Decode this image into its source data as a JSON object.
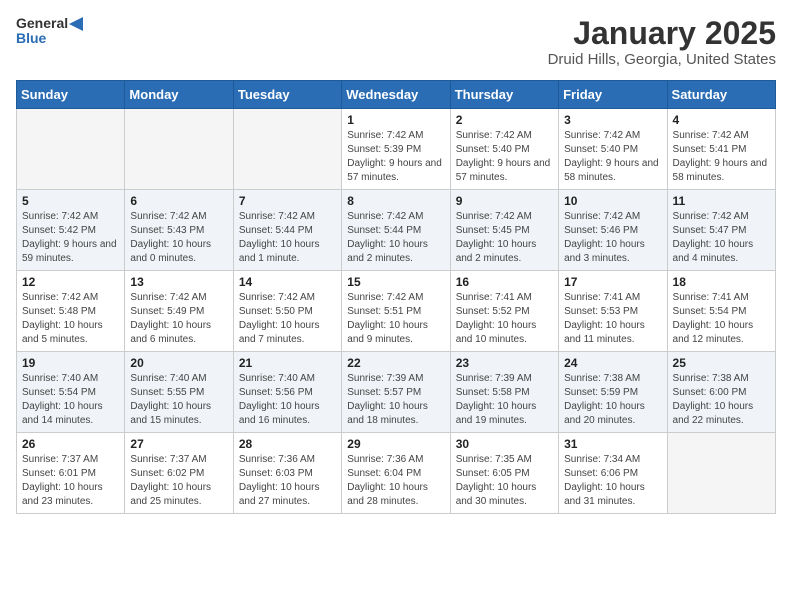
{
  "header": {
    "logo_general": "General",
    "logo_blue": "Blue",
    "month_title": "January 2025",
    "location": "Druid Hills, Georgia, United States"
  },
  "weekdays": [
    "Sunday",
    "Monday",
    "Tuesday",
    "Wednesday",
    "Thursday",
    "Friday",
    "Saturday"
  ],
  "weeks": [
    [
      {
        "day": "",
        "info": ""
      },
      {
        "day": "",
        "info": ""
      },
      {
        "day": "",
        "info": ""
      },
      {
        "day": "1",
        "info": "Sunrise: 7:42 AM\nSunset: 5:39 PM\nDaylight: 9 hours and 57 minutes."
      },
      {
        "day": "2",
        "info": "Sunrise: 7:42 AM\nSunset: 5:40 PM\nDaylight: 9 hours and 57 minutes."
      },
      {
        "day": "3",
        "info": "Sunrise: 7:42 AM\nSunset: 5:40 PM\nDaylight: 9 hours and 58 minutes."
      },
      {
        "day": "4",
        "info": "Sunrise: 7:42 AM\nSunset: 5:41 PM\nDaylight: 9 hours and 58 minutes."
      }
    ],
    [
      {
        "day": "5",
        "info": "Sunrise: 7:42 AM\nSunset: 5:42 PM\nDaylight: 9 hours and 59 minutes."
      },
      {
        "day": "6",
        "info": "Sunrise: 7:42 AM\nSunset: 5:43 PM\nDaylight: 10 hours and 0 minutes."
      },
      {
        "day": "7",
        "info": "Sunrise: 7:42 AM\nSunset: 5:44 PM\nDaylight: 10 hours and 1 minute."
      },
      {
        "day": "8",
        "info": "Sunrise: 7:42 AM\nSunset: 5:44 PM\nDaylight: 10 hours and 2 minutes."
      },
      {
        "day": "9",
        "info": "Sunrise: 7:42 AM\nSunset: 5:45 PM\nDaylight: 10 hours and 2 minutes."
      },
      {
        "day": "10",
        "info": "Sunrise: 7:42 AM\nSunset: 5:46 PM\nDaylight: 10 hours and 3 minutes."
      },
      {
        "day": "11",
        "info": "Sunrise: 7:42 AM\nSunset: 5:47 PM\nDaylight: 10 hours and 4 minutes."
      }
    ],
    [
      {
        "day": "12",
        "info": "Sunrise: 7:42 AM\nSunset: 5:48 PM\nDaylight: 10 hours and 5 minutes."
      },
      {
        "day": "13",
        "info": "Sunrise: 7:42 AM\nSunset: 5:49 PM\nDaylight: 10 hours and 6 minutes."
      },
      {
        "day": "14",
        "info": "Sunrise: 7:42 AM\nSunset: 5:50 PM\nDaylight: 10 hours and 7 minutes."
      },
      {
        "day": "15",
        "info": "Sunrise: 7:42 AM\nSunset: 5:51 PM\nDaylight: 10 hours and 9 minutes."
      },
      {
        "day": "16",
        "info": "Sunrise: 7:41 AM\nSunset: 5:52 PM\nDaylight: 10 hours and 10 minutes."
      },
      {
        "day": "17",
        "info": "Sunrise: 7:41 AM\nSunset: 5:53 PM\nDaylight: 10 hours and 11 minutes."
      },
      {
        "day": "18",
        "info": "Sunrise: 7:41 AM\nSunset: 5:54 PM\nDaylight: 10 hours and 12 minutes."
      }
    ],
    [
      {
        "day": "19",
        "info": "Sunrise: 7:40 AM\nSunset: 5:54 PM\nDaylight: 10 hours and 14 minutes."
      },
      {
        "day": "20",
        "info": "Sunrise: 7:40 AM\nSunset: 5:55 PM\nDaylight: 10 hours and 15 minutes."
      },
      {
        "day": "21",
        "info": "Sunrise: 7:40 AM\nSunset: 5:56 PM\nDaylight: 10 hours and 16 minutes."
      },
      {
        "day": "22",
        "info": "Sunrise: 7:39 AM\nSunset: 5:57 PM\nDaylight: 10 hours and 18 minutes."
      },
      {
        "day": "23",
        "info": "Sunrise: 7:39 AM\nSunset: 5:58 PM\nDaylight: 10 hours and 19 minutes."
      },
      {
        "day": "24",
        "info": "Sunrise: 7:38 AM\nSunset: 5:59 PM\nDaylight: 10 hours and 20 minutes."
      },
      {
        "day": "25",
        "info": "Sunrise: 7:38 AM\nSunset: 6:00 PM\nDaylight: 10 hours and 22 minutes."
      }
    ],
    [
      {
        "day": "26",
        "info": "Sunrise: 7:37 AM\nSunset: 6:01 PM\nDaylight: 10 hours and 23 minutes."
      },
      {
        "day": "27",
        "info": "Sunrise: 7:37 AM\nSunset: 6:02 PM\nDaylight: 10 hours and 25 minutes."
      },
      {
        "day": "28",
        "info": "Sunrise: 7:36 AM\nSunset: 6:03 PM\nDaylight: 10 hours and 27 minutes."
      },
      {
        "day": "29",
        "info": "Sunrise: 7:36 AM\nSunset: 6:04 PM\nDaylight: 10 hours and 28 minutes."
      },
      {
        "day": "30",
        "info": "Sunrise: 7:35 AM\nSunset: 6:05 PM\nDaylight: 10 hours and 30 minutes."
      },
      {
        "day": "31",
        "info": "Sunrise: 7:34 AM\nSunset: 6:06 PM\nDaylight: 10 hours and 31 minutes."
      },
      {
        "day": "",
        "info": ""
      }
    ]
  ]
}
